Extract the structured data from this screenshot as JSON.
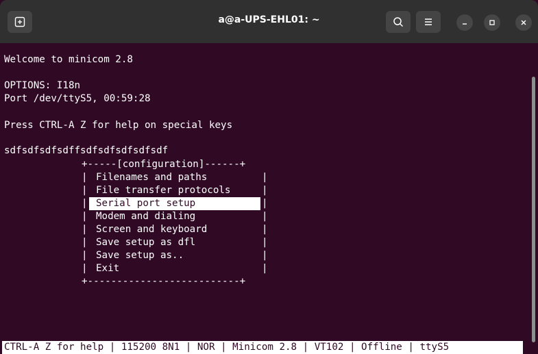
{
  "window": {
    "title": "a@a-UPS-EHL01: ~"
  },
  "icons": {
    "new_tab": "new-tab-icon",
    "search": "search-icon",
    "menu": "hamburger-menu-icon",
    "minimize": "minimize-icon",
    "maximize": "maximize-icon",
    "close": "close-icon"
  },
  "colors": {
    "terminal_background": "#300a24",
    "terminal_foreground": "#ffffff",
    "titlebar": "#303030"
  },
  "terminal": {
    "welcome": "Welcome to minicom 2.8",
    "options": "OPTIONS: I18n",
    "port": "Port /dev/ttyS5, 00:59:28",
    "help_hint": "Press CTRL-A Z for help on special keys",
    "typed": "sdfsdfsdfsdffsdfsdfsdfsdfsdf"
  },
  "config_menu": {
    "top_border": "+-----[configuration]------+",
    "bottom_border": "+--------------------------+",
    "left_edge": "|",
    "right_edge": "|",
    "selected_index": 2,
    "items": [
      "Filenames and paths",
      "File transfer protocols",
      "Serial port setup",
      "Modem and dialing",
      "Screen and keyboard",
      "Save setup as dfl",
      "Save setup as..",
      "Exit"
    ]
  },
  "status_bar": {
    "text": "CTRL-A Z for help | 115200 8N1 | NOR | Minicom 2.8 | VT102 | Offline | ttyS5"
  }
}
